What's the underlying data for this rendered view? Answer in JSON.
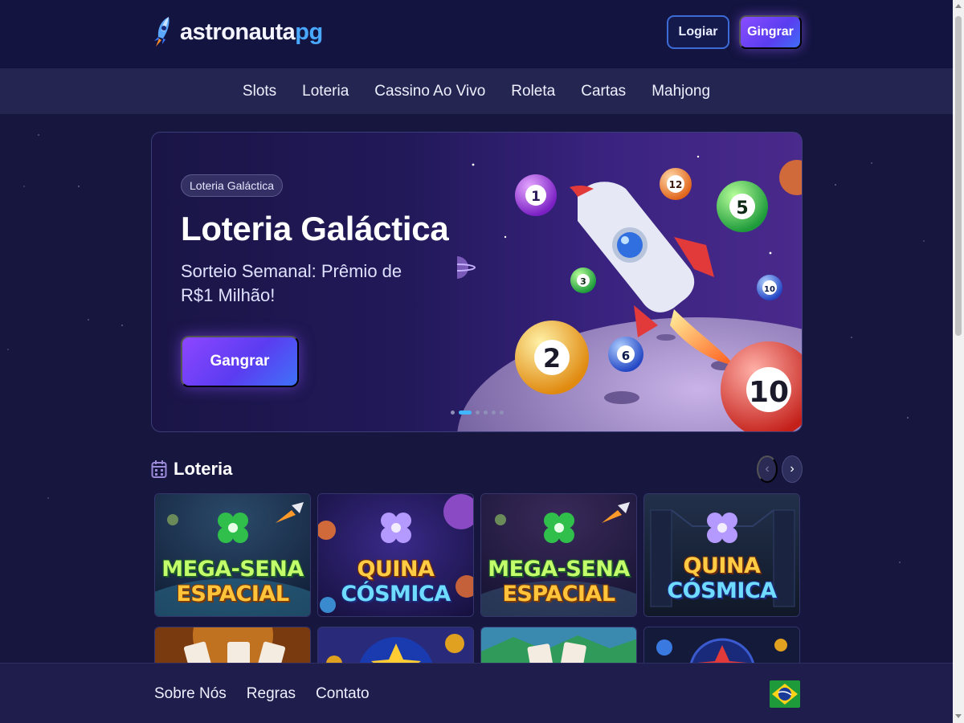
{
  "brand": {
    "name_main": "astronauta",
    "name_suffix": "pg"
  },
  "header": {
    "login_label": "Logiar",
    "signup_label": "Gingrar"
  },
  "nav": {
    "items": [
      "Slots",
      "Loteria",
      "Cassino Ao Vivo",
      "Roleta",
      "Cartas",
      "Mahjong"
    ]
  },
  "hero": {
    "badge": "Loteria Galáctica",
    "title": "Loteria Galáctica",
    "subtitle": "Sorteio Semanal: Prêmio de R$1 Milhão!",
    "cta_label": "Gangrar",
    "slides_total": 6,
    "active_slide": 2,
    "balls": [
      "1",
      "12",
      "5",
      "3",
      "10",
      "2",
      "6",
      "10"
    ]
  },
  "lottery_section": {
    "title": "Loteria",
    "cards": [
      {
        "line1": "MEGA-SENA",
        "line2": "ESPACIAL",
        "style": "mega"
      },
      {
        "line1": "QUINA",
        "line2": "CÓSMICA",
        "style": "quina"
      },
      {
        "line1": "MEGA-SENA",
        "line2": "ESPACIAL",
        "style": "mega"
      },
      {
        "line1": "QUINA",
        "line2": "CÓSMICA",
        "style": "quina"
      }
    ]
  },
  "footer": {
    "links": [
      "Sobre Nós",
      "Regras",
      "Contato"
    ],
    "flag": "brazil-flag"
  },
  "colors": {
    "background": "#16163f",
    "accent_purple": "#8a4dff",
    "accent_blue": "#3fb6ff",
    "header": "#141440",
    "nav": "#252552"
  },
  "icons": [
    "rocket-icon",
    "calendar-icon",
    "chevron-left-icon",
    "chevron-right-icon",
    "clover-icon"
  ]
}
